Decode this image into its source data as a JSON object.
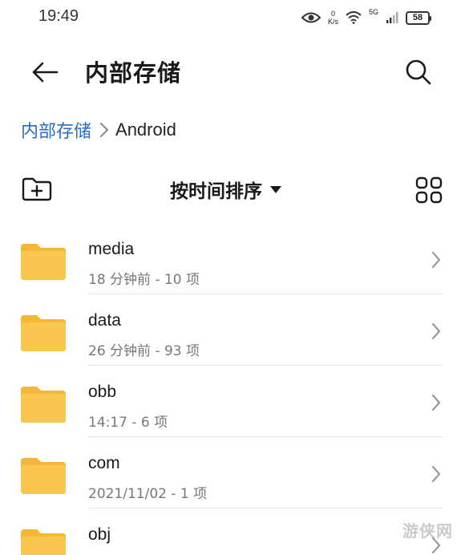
{
  "status_bar": {
    "time": "19:49",
    "net_speed_value": "0",
    "net_speed_unit": "K/s",
    "network_type": "5G",
    "battery": "58",
    "icons": [
      "eye-icon",
      "wifi-icon",
      "signal-icon",
      "battery-icon"
    ]
  },
  "header": {
    "title": "内部存储",
    "back_icon": "arrow-left-icon",
    "search_icon": "search-icon"
  },
  "breadcrumb": {
    "root": "内部存储",
    "current": "Android"
  },
  "toolbar": {
    "sort_label": "按时间排序",
    "new_folder_icon": "new-folder-icon",
    "grid_icon": "grid-view-icon"
  },
  "files": [
    {
      "name": "media",
      "meta": "18 分钟前 - 10 项"
    },
    {
      "name": "data",
      "meta": "26 分钟前 - 93 项"
    },
    {
      "name": "obb",
      "meta": "14:17 - 6 项"
    },
    {
      "name": "com",
      "meta": "2021/11/02 - 1 项"
    },
    {
      "name": "obj",
      "meta": ""
    }
  ],
  "watermark": "游侠网",
  "colors": {
    "folder": "#f9c74f",
    "folder_tab": "#f4b73a",
    "accent_link": "#2a6cc6"
  }
}
